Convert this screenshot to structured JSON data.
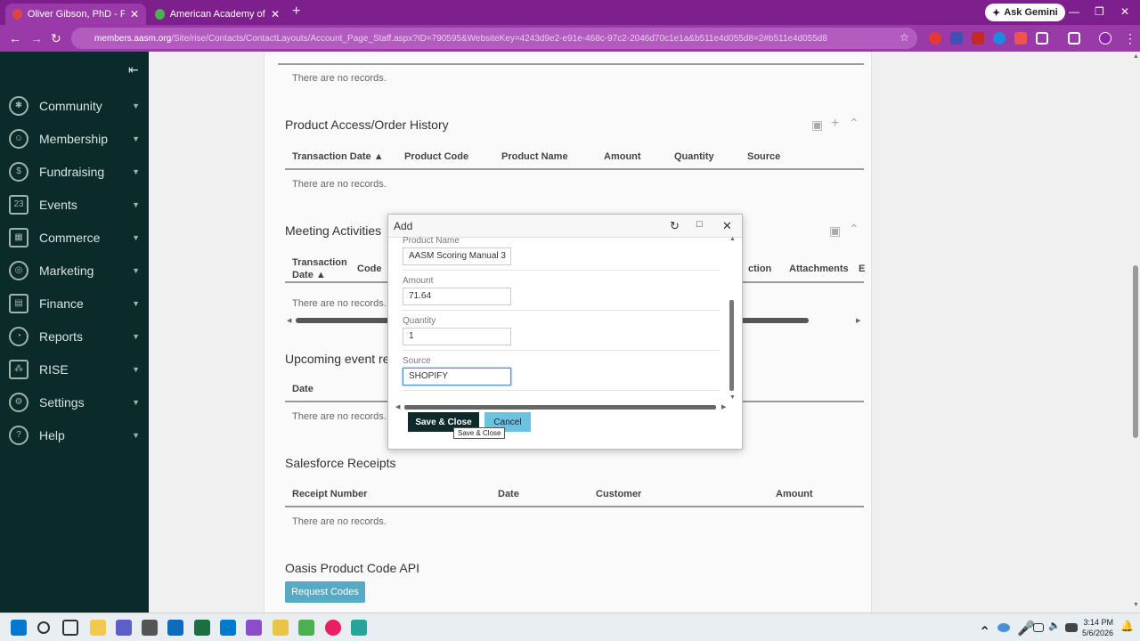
{
  "browser": {
    "tabs": [
      {
        "title": "Oliver Gibson, PhD - Purchase",
        "active": true
      },
      {
        "title": "American Academy of Sleep Me",
        "active": false
      }
    ],
    "gemini_label": "Ask Gemini",
    "url_host": "members.aasm.org",
    "url_rest": "/Site/rise/Contacts/ContactLayouts/Account_Page_Staff.aspx?ID=790595&WebsiteKey=4243d9e2-e91e-468c-97c2-2046d70c1e1a&b511e4d055d8=2#b511e4d055d8"
  },
  "sidebar": {
    "items": [
      {
        "label": "Community"
      },
      {
        "label": "Membership"
      },
      {
        "label": "Fundraising"
      },
      {
        "label": "Events"
      },
      {
        "label": "Commerce"
      },
      {
        "label": "Marketing"
      },
      {
        "label": "Finance"
      },
      {
        "label": "Reports"
      },
      {
        "label": "RISE"
      },
      {
        "label": "Settings"
      },
      {
        "label": "Help"
      }
    ],
    "events_icon_text": "23"
  },
  "sections": {
    "invoice": {
      "no_records": "There are no records."
    },
    "product_access": {
      "title": "Product Access/Order History",
      "columns": [
        "Transaction Date ▲",
        "Product Code",
        "Product Name",
        "Amount",
        "Quantity",
        "Source"
      ],
      "no_records": "There are no records."
    },
    "meeting": {
      "title": "Meeting Activities",
      "col_transaction": "Transaction",
      "col_date": "Date ▲",
      "col_code": "Code",
      "col_action": "ction",
      "col_attachments": "Attachments",
      "col_e": "E",
      "no_records": "There are no records."
    },
    "upcoming": {
      "title": "Upcoming event re",
      "col_date": "Date",
      "no_records": "There are no records."
    },
    "salesforce": {
      "title": "Salesforce Receipts",
      "columns": [
        "Receipt Number",
        "Date",
        "Customer",
        "Amount"
      ],
      "no_records": "There are no records."
    },
    "oasis": {
      "title": "Oasis Product Code API",
      "button": "Request Codes"
    }
  },
  "dialog": {
    "title": "Add",
    "fields": [
      {
        "label": "Product Name",
        "value": "AASM Scoring Manual 3"
      },
      {
        "label": "Amount",
        "value": "71.64"
      },
      {
        "label": "Quantity",
        "value": "1"
      },
      {
        "label": "Source",
        "value": "SHOPIFY"
      }
    ],
    "save_label": "Save & Close",
    "cancel_label": "Cancel",
    "tooltip": "Save & Close"
  },
  "taskbar": {
    "time": "3:14 PM",
    "date": "5/6/2026"
  }
}
